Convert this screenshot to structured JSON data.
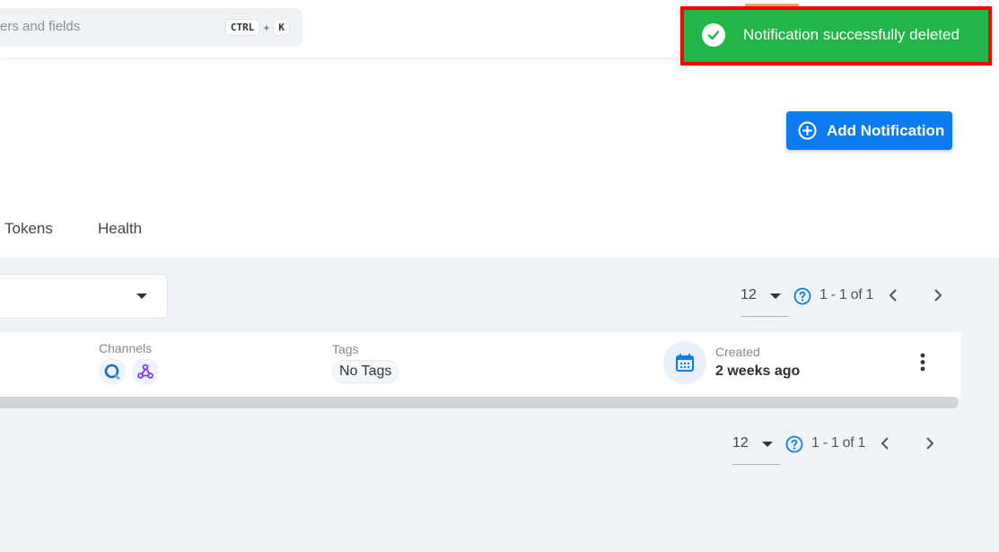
{
  "search": {
    "placeholder_visible": "ers and fields",
    "shortcut_key1": "CTRL",
    "shortcut_plus": "+",
    "shortcut_key2": "K"
  },
  "toast": {
    "message": "Notification successfully deleted",
    "icon": "check-circle-icon",
    "color": "#22b547",
    "highlight_color": "#ff0000"
  },
  "header": {
    "add_button_label": "Add Notification",
    "add_button_icon": "plus-circle-icon",
    "accent": "#0a7cf0"
  },
  "tabs": [
    {
      "label": "Tokens"
    },
    {
      "label": "Health"
    }
  ],
  "filter": {
    "value": ""
  },
  "pagination_top": {
    "page_size": "12",
    "range": "1 - 1 of 1"
  },
  "pagination_bottom": {
    "page_size": "12",
    "range": "1 - 1 of 1"
  },
  "notification_row": {
    "channels_label": "Channels",
    "channels": [
      {
        "name": "qualytics-icon"
      },
      {
        "name": "webhook-icon"
      }
    ],
    "tags_label": "Tags",
    "tags_value": "No Tags",
    "created_label": "Created",
    "created_value": "2 weeks ago"
  }
}
